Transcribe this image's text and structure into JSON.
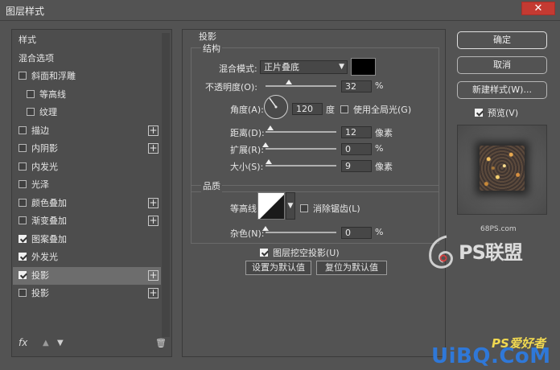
{
  "window": {
    "title": "图层样式",
    "close_label": "✕"
  },
  "sidebar": {
    "items": [
      {
        "label": "样式"
      },
      {
        "label": "混合选项"
      },
      {
        "label": "斜面和浮雕"
      },
      {
        "label": "等高线"
      },
      {
        "label": "纹理"
      },
      {
        "label": "描边",
        "plus": "+"
      },
      {
        "label": "内阴影",
        "plus": "+"
      },
      {
        "label": "内发光"
      },
      {
        "label": "光泽"
      },
      {
        "label": "颜色叠加",
        "plus": "+"
      },
      {
        "label": "渐变叠加",
        "plus": "+"
      },
      {
        "label": "图案叠加",
        "checked": true
      },
      {
        "label": "外发光",
        "checked": true
      },
      {
        "label": "投影",
        "checked": true,
        "plus": "+"
      },
      {
        "label": "投影",
        "plus": "+"
      }
    ],
    "footer": {
      "fx_label": "fx",
      "up_icon": "▲",
      "down_icon": "▼",
      "trash_icon": "🗑"
    }
  },
  "drop_shadow": {
    "section_title": "投影",
    "structure": {
      "group_label": "结构",
      "blend_mode_label": "混合模式:",
      "blend_mode_value": "正片叠底",
      "blend_color": "#000000",
      "opacity_label": "不透明度(O):",
      "opacity_value": "32",
      "opacity_unit": "%",
      "angle_label": "角度(A):",
      "angle_value": "120",
      "angle_unit": "度",
      "global_light_label": "使用全局光(G)",
      "distance_label": "距离(D):",
      "distance_value": "12",
      "distance_unit": "像素",
      "spread_label": "扩展(R):",
      "spread_value": "0",
      "spread_unit": "%",
      "size_label": "大小(S):",
      "size_value": "9",
      "size_unit": "像素"
    },
    "quality": {
      "group_label": "品质",
      "contour_label": "等高线:",
      "anti_alias_label": "消除锯齿(L)",
      "noise_label": "杂色(N):",
      "noise_value": "0",
      "noise_unit": "%"
    },
    "knockout_label": "图层挖空投影(U)",
    "make_default_label": "设置为默认值",
    "reset_default_label": "复位为默认值"
  },
  "right_panel": {
    "ok_label": "确定",
    "cancel_label": "取消",
    "new_style_label": "新建样式(W)...",
    "preview_label": "预览(V)"
  },
  "watermark": {
    "site": "68PS.com",
    "logo_text": "PS联盟",
    "ps_text": "PS爱好者",
    "uibq_text": "UiBQ.CoM"
  }
}
